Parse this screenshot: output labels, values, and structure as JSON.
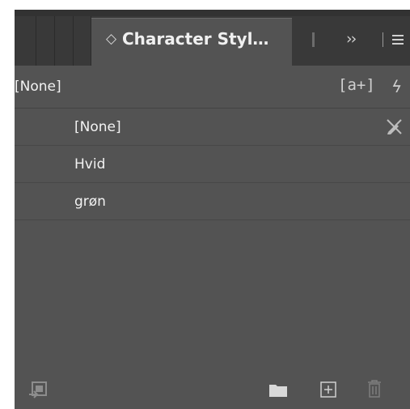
{
  "panel": {
    "tab_title": "Character Styl…",
    "tab_chevron": "◇",
    "overflow_chevrons": "››",
    "menu_icon": "hamburger-menu-icon"
  },
  "header": {
    "label": "[None]",
    "new_group_icon_text": "[a+]",
    "bolt_icon_text": "ϟ"
  },
  "styles": [
    {
      "label": "[None]",
      "has_pen_icon": true
    },
    {
      "label": "Hvid"
    },
    {
      "label": "grøn"
    }
  ],
  "footer": {
    "icons": [
      "load-styles-icon",
      "folder-icon",
      "new-style-icon",
      "trash-icon"
    ]
  },
  "colors": {
    "panel_bg": "#535353",
    "tabbar_bg": "#393939",
    "text": "#f2f2f2",
    "icon": "#d0d0d0"
  }
}
